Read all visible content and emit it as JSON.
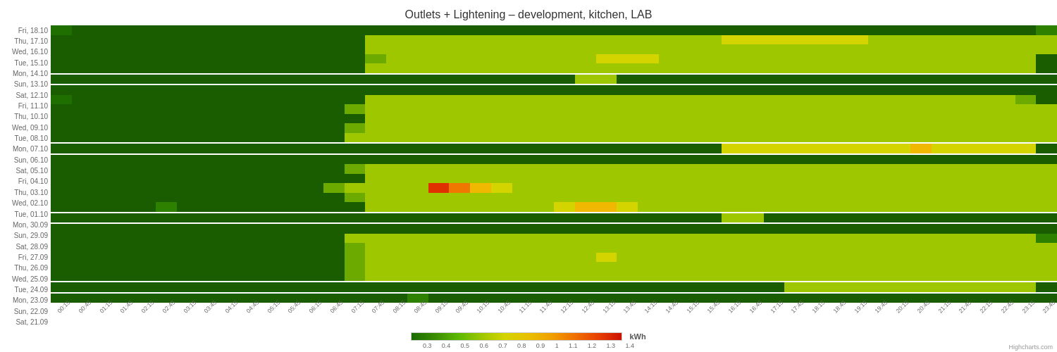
{
  "title": "Outlets + Lightening – development, kitchen, LAB",
  "yLabels": [
    "Fri, 18.10",
    "Thu, 17.10",
    "Wed, 16.10",
    "Tue, 15.10",
    "Mon, 14.10",
    "Sun, 13.10",
    "Sat, 12.10",
    "Fri, 11.10",
    "Thu, 10.10",
    "Wed, 09.10",
    "Tue, 08.10",
    "Mon, 07.10",
    "Sun, 06.10",
    "Sat, 05.10",
    "Fri, 04.10",
    "Thu, 03.10",
    "Wed, 02.10",
    "Tue, 01.10",
    "Mon, 30.09",
    "Sun, 29.09",
    "Sat, 28.09",
    "Fri, 27.09",
    "Thu, 26.09",
    "Wed, 25.09",
    "Tue, 24.09",
    "Mon, 23.09",
    "Sun, 22.09",
    "Sat, 21.09"
  ],
  "xLabels": [
    "00:15",
    "00:45",
    "01:15",
    "01:45",
    "02:15",
    "02:45",
    "03:15",
    "03:45",
    "04:15",
    "04:45",
    "05:15",
    "05:45",
    "06:15",
    "06:45",
    "07:15",
    "07:45",
    "08:15",
    "08:45",
    "09:15",
    "09:45",
    "10:15",
    "10:45",
    "11:15",
    "11:45",
    "12:15",
    "12:45",
    "13:15",
    "13:45",
    "14:15",
    "14:45",
    "15:15",
    "15:45",
    "16:15",
    "16:45",
    "17:15",
    "17:45",
    "18:15",
    "18:45",
    "19:15",
    "19:45",
    "20:15",
    "20:45",
    "21:15",
    "21:45",
    "22:15",
    "22:45",
    "23:15",
    "23:45"
  ],
  "legend": {
    "ticks": [
      "0.3",
      "0.4",
      "0.5",
      "0.6",
      "0.7",
      "0.8",
      "0.9",
      "1",
      "1.1",
      "1.2",
      "1.3",
      "1.4"
    ],
    "unit": "kWh"
  },
  "credit": "Highcharts.com",
  "weekendRows": [
    5,
    6,
    12,
    13,
    19,
    20,
    26,
    27
  ],
  "heatmapData": [
    [
      1,
      0,
      0,
      0,
      0,
      0,
      0,
      0,
      0,
      0,
      0,
      0,
      0,
      0,
      0,
      0,
      0,
      0,
      0,
      0,
      0,
      0,
      0,
      0,
      0,
      0,
      0,
      0,
      0,
      0,
      0,
      0,
      0,
      0,
      0,
      0,
      0,
      0,
      0,
      0,
      0,
      0,
      0,
      0,
      0,
      0,
      0,
      2
    ],
    [
      0,
      0,
      0,
      0,
      0,
      0,
      0,
      0,
      0,
      0,
      0,
      0,
      0,
      0,
      0,
      5,
      5,
      5,
      5,
      5,
      5,
      5,
      5,
      5,
      5,
      5,
      5,
      5,
      5,
      5,
      5,
      5,
      6,
      6,
      6,
      6,
      6,
      6,
      6,
      5,
      5,
      5,
      5,
      5,
      5,
      5,
      5,
      5
    ],
    [
      0,
      0,
      0,
      0,
      0,
      0,
      0,
      0,
      0,
      0,
      0,
      0,
      0,
      0,
      0,
      5,
      5,
      5,
      5,
      5,
      5,
      5,
      5,
      5,
      5,
      5,
      5,
      5,
      5,
      5,
      5,
      5,
      5,
      5,
      5,
      5,
      5,
      5,
      5,
      5,
      5,
      5,
      5,
      5,
      5,
      5,
      5,
      5
    ],
    [
      0,
      0,
      0,
      0,
      0,
      0,
      0,
      0,
      0,
      0,
      0,
      0,
      0,
      0,
      0,
      4,
      5,
      5,
      5,
      5,
      5,
      5,
      5,
      5,
      5,
      5,
      6,
      6,
      6,
      5,
      5,
      5,
      5,
      5,
      5,
      5,
      5,
      5,
      5,
      5,
      5,
      5,
      5,
      5,
      5,
      5,
      5,
      0
    ],
    [
      0,
      0,
      0,
      0,
      0,
      0,
      0,
      0,
      0,
      0,
      0,
      0,
      0,
      0,
      0,
      5,
      5,
      5,
      5,
      5,
      5,
      5,
      5,
      5,
      5,
      5,
      5,
      5,
      5,
      5,
      5,
      5,
      5,
      5,
      5,
      5,
      5,
      5,
      5,
      5,
      5,
      5,
      5,
      5,
      5,
      5,
      5,
      0
    ],
    [
      0,
      0,
      0,
      0,
      0,
      0,
      0,
      0,
      0,
      0,
      0,
      0,
      0,
      0,
      0,
      0,
      0,
      0,
      0,
      0,
      0,
      0,
      0,
      0,
      0,
      5,
      5,
      0,
      0,
      0,
      0,
      0,
      0,
      0,
      0,
      0,
      0,
      0,
      0,
      0,
      0,
      0,
      0,
      0,
      0,
      0,
      0,
      0
    ],
    [
      0,
      0,
      0,
      0,
      0,
      0,
      0,
      0,
      0,
      0,
      0,
      0,
      0,
      0,
      0,
      0,
      0,
      0,
      0,
      0,
      0,
      0,
      0,
      0,
      0,
      0,
      0,
      0,
      0,
      0,
      0,
      0,
      0,
      0,
      0,
      0,
      0,
      0,
      0,
      0,
      0,
      0,
      0,
      0,
      0,
      0,
      0,
      0
    ],
    [
      1,
      0,
      0,
      0,
      0,
      0,
      0,
      0,
      0,
      0,
      0,
      0,
      0,
      0,
      0,
      5,
      5,
      5,
      5,
      5,
      5,
      5,
      5,
      5,
      5,
      5,
      5,
      5,
      5,
      5,
      5,
      5,
      5,
      5,
      5,
      5,
      5,
      5,
      5,
      5,
      5,
      5,
      5,
      5,
      5,
      5,
      4,
      0
    ],
    [
      0,
      0,
      0,
      0,
      0,
      0,
      0,
      0,
      0,
      0,
      0,
      0,
      0,
      0,
      4,
      5,
      5,
      5,
      5,
      5,
      5,
      5,
      5,
      5,
      5,
      5,
      5,
      5,
      5,
      5,
      5,
      5,
      5,
      5,
      5,
      5,
      5,
      5,
      5,
      5,
      5,
      5,
      5,
      5,
      5,
      5,
      5,
      5
    ],
    [
      0,
      0,
      0,
      0,
      0,
      0,
      0,
      0,
      0,
      0,
      0,
      0,
      0,
      0,
      0,
      5,
      5,
      5,
      5,
      5,
      5,
      5,
      5,
      5,
      5,
      5,
      5,
      5,
      5,
      5,
      5,
      5,
      5,
      5,
      5,
      5,
      5,
      5,
      5,
      5,
      5,
      5,
      5,
      5,
      5,
      5,
      5,
      5
    ],
    [
      0,
      0,
      0,
      0,
      0,
      0,
      0,
      0,
      0,
      0,
      0,
      0,
      0,
      0,
      4,
      5,
      5,
      5,
      5,
      5,
      5,
      5,
      5,
      5,
      5,
      5,
      5,
      5,
      5,
      5,
      5,
      5,
      5,
      5,
      5,
      5,
      5,
      5,
      5,
      5,
      5,
      5,
      5,
      5,
      5,
      5,
      5,
      5
    ],
    [
      0,
      0,
      0,
      0,
      0,
      0,
      0,
      0,
      0,
      0,
      0,
      0,
      0,
      0,
      5,
      5,
      5,
      5,
      5,
      5,
      5,
      5,
      5,
      5,
      5,
      5,
      5,
      5,
      5,
      5,
      5,
      5,
      5,
      5,
      5,
      5,
      5,
      5,
      5,
      5,
      5,
      5,
      5,
      5,
      5,
      5,
      5,
      5
    ],
    [
      0,
      0,
      0,
      0,
      0,
      0,
      0,
      0,
      0,
      0,
      0,
      0,
      0,
      0,
      0,
      0,
      0,
      0,
      0,
      0,
      0,
      0,
      0,
      0,
      0,
      0,
      0,
      0,
      0,
      0,
      0,
      0,
      6,
      6,
      6,
      6,
      6,
      6,
      6,
      6,
      6,
      7,
      6,
      6,
      6,
      6,
      6,
      0
    ],
    [
      0,
      0,
      0,
      0,
      0,
      0,
      0,
      0,
      0,
      0,
      0,
      0,
      0,
      0,
      0,
      0,
      0,
      0,
      0,
      0,
      0,
      0,
      0,
      0,
      0,
      0,
      0,
      0,
      0,
      0,
      0,
      0,
      0,
      0,
      0,
      0,
      0,
      0,
      0,
      0,
      0,
      0,
      0,
      0,
      0,
      0,
      0,
      0
    ],
    [
      0,
      0,
      0,
      0,
      0,
      0,
      0,
      0,
      0,
      0,
      0,
      0,
      0,
      0,
      4,
      5,
      5,
      5,
      5,
      5,
      5,
      5,
      5,
      5,
      5,
      5,
      5,
      5,
      5,
      5,
      5,
      5,
      5,
      5,
      5,
      5,
      5,
      5,
      5,
      5,
      5,
      5,
      5,
      5,
      5,
      5,
      5,
      5
    ],
    [
      0,
      0,
      0,
      0,
      0,
      0,
      0,
      0,
      0,
      0,
      0,
      0,
      0,
      0,
      0,
      5,
      5,
      5,
      5,
      5,
      5,
      5,
      5,
      5,
      5,
      5,
      5,
      5,
      5,
      5,
      5,
      5,
      5,
      5,
      5,
      5,
      5,
      5,
      5,
      5,
      5,
      5,
      5,
      5,
      5,
      5,
      5,
      5
    ],
    [
      0,
      0,
      0,
      0,
      0,
      0,
      0,
      0,
      0,
      0,
      0,
      0,
      0,
      4,
      5,
      5,
      5,
      5,
      9,
      8,
      7,
      6,
      5,
      5,
      5,
      5,
      5,
      5,
      5,
      5,
      5,
      5,
      5,
      5,
      5,
      5,
      5,
      5,
      5,
      5,
      5,
      5,
      5,
      5,
      5,
      5,
      5,
      5
    ],
    [
      0,
      0,
      0,
      0,
      0,
      0,
      0,
      0,
      0,
      0,
      0,
      0,
      0,
      0,
      4,
      5,
      5,
      5,
      5,
      5,
      5,
      5,
      5,
      5,
      5,
      5,
      5,
      5,
      5,
      5,
      5,
      5,
      5,
      5,
      5,
      5,
      5,
      5,
      5,
      5,
      5,
      5,
      5,
      5,
      5,
      5,
      5,
      5
    ],
    [
      0,
      0,
      0,
      0,
      0,
      2,
      0,
      0,
      0,
      0,
      0,
      0,
      0,
      0,
      0,
      5,
      5,
      5,
      5,
      5,
      5,
      5,
      5,
      5,
      6,
      7,
      7,
      6,
      5,
      5,
      5,
      5,
      5,
      5,
      5,
      5,
      5,
      5,
      5,
      5,
      5,
      5,
      5,
      5,
      5,
      5,
      5,
      5
    ],
    [
      0,
      0,
      0,
      0,
      0,
      0,
      0,
      0,
      0,
      0,
      0,
      0,
      0,
      0,
      0,
      0,
      0,
      0,
      0,
      0,
      0,
      0,
      0,
      0,
      0,
      0,
      0,
      0,
      0,
      0,
      0,
      0,
      5,
      5,
      0,
      0,
      0,
      0,
      0,
      0,
      0,
      0,
      0,
      0,
      0,
      0,
      0,
      0
    ],
    [
      0,
      0,
      0,
      0,
      0,
      0,
      0,
      0,
      0,
      0,
      0,
      0,
      0,
      0,
      0,
      0,
      0,
      0,
      0,
      0,
      0,
      0,
      0,
      0,
      0,
      0,
      0,
      0,
      0,
      0,
      0,
      0,
      0,
      0,
      0,
      0,
      0,
      0,
      0,
      0,
      0,
      0,
      0,
      0,
      0,
      0,
      0,
      0
    ],
    [
      0,
      0,
      0,
      0,
      0,
      0,
      0,
      0,
      0,
      0,
      0,
      0,
      0,
      0,
      5,
      5,
      5,
      5,
      5,
      5,
      5,
      5,
      5,
      5,
      5,
      5,
      5,
      5,
      5,
      5,
      5,
      5,
      5,
      5,
      5,
      5,
      5,
      5,
      5,
      5,
      5,
      5,
      5,
      5,
      5,
      5,
      5,
      2
    ],
    [
      0,
      0,
      0,
      0,
      0,
      0,
      0,
      0,
      0,
      0,
      0,
      0,
      0,
      0,
      4,
      5,
      5,
      5,
      5,
      5,
      5,
      5,
      5,
      5,
      5,
      5,
      5,
      5,
      5,
      5,
      5,
      5,
      5,
      5,
      5,
      5,
      5,
      5,
      5,
      5,
      5,
      5,
      5,
      5,
      5,
      5,
      5,
      5
    ],
    [
      0,
      0,
      0,
      0,
      0,
      0,
      0,
      0,
      0,
      0,
      0,
      0,
      0,
      0,
      4,
      5,
      5,
      5,
      5,
      5,
      5,
      5,
      5,
      5,
      5,
      5,
      6,
      5,
      5,
      5,
      5,
      5,
      5,
      5,
      5,
      5,
      5,
      5,
      5,
      5,
      5,
      5,
      5,
      5,
      5,
      5,
      5,
      5
    ],
    [
      0,
      0,
      0,
      0,
      0,
      0,
      0,
      0,
      0,
      0,
      0,
      0,
      0,
      0,
      4,
      5,
      5,
      5,
      5,
      5,
      5,
      5,
      5,
      5,
      5,
      5,
      5,
      5,
      5,
      5,
      5,
      5,
      5,
      5,
      5,
      5,
      5,
      5,
      5,
      5,
      5,
      5,
      5,
      5,
      5,
      5,
      5,
      5
    ],
    [
      0,
      0,
      0,
      0,
      0,
      0,
      0,
      0,
      0,
      0,
      0,
      0,
      0,
      0,
      4,
      5,
      5,
      5,
      5,
      5,
      5,
      5,
      5,
      5,
      5,
      5,
      5,
      5,
      5,
      5,
      5,
      5,
      5,
      5,
      5,
      5,
      5,
      5,
      5,
      5,
      5,
      5,
      5,
      5,
      5,
      5,
      5,
      5
    ],
    [
      0,
      0,
      0,
      0,
      0,
      0,
      0,
      0,
      0,
      0,
      0,
      0,
      0,
      0,
      0,
      0,
      0,
      0,
      0,
      0,
      0,
      0,
      0,
      0,
      0,
      0,
      0,
      0,
      0,
      0,
      0,
      0,
      0,
      0,
      0,
      5,
      5,
      5,
      5,
      5,
      5,
      5,
      5,
      5,
      5,
      5,
      5,
      0
    ],
    [
      0,
      0,
      0,
      0,
      0,
      0,
      0,
      0,
      0,
      0,
      0,
      0,
      0,
      0,
      0,
      0,
      0,
      2,
      0,
      0,
      0,
      0,
      0,
      0,
      0,
      0,
      0,
      0,
      0,
      0,
      0,
      0,
      0,
      0,
      0,
      0,
      0,
      0,
      0,
      0,
      0,
      0,
      0,
      0,
      0,
      0,
      0,
      0
    ]
  ],
  "colorScale": [
    "#1a5c00",
    "#1f6e00",
    "#2d8000",
    "#469400",
    "#6caa00",
    "#9ec700",
    "#d4d400",
    "#f0b800",
    "#f07800",
    "#e03000",
    "#cc0000"
  ]
}
